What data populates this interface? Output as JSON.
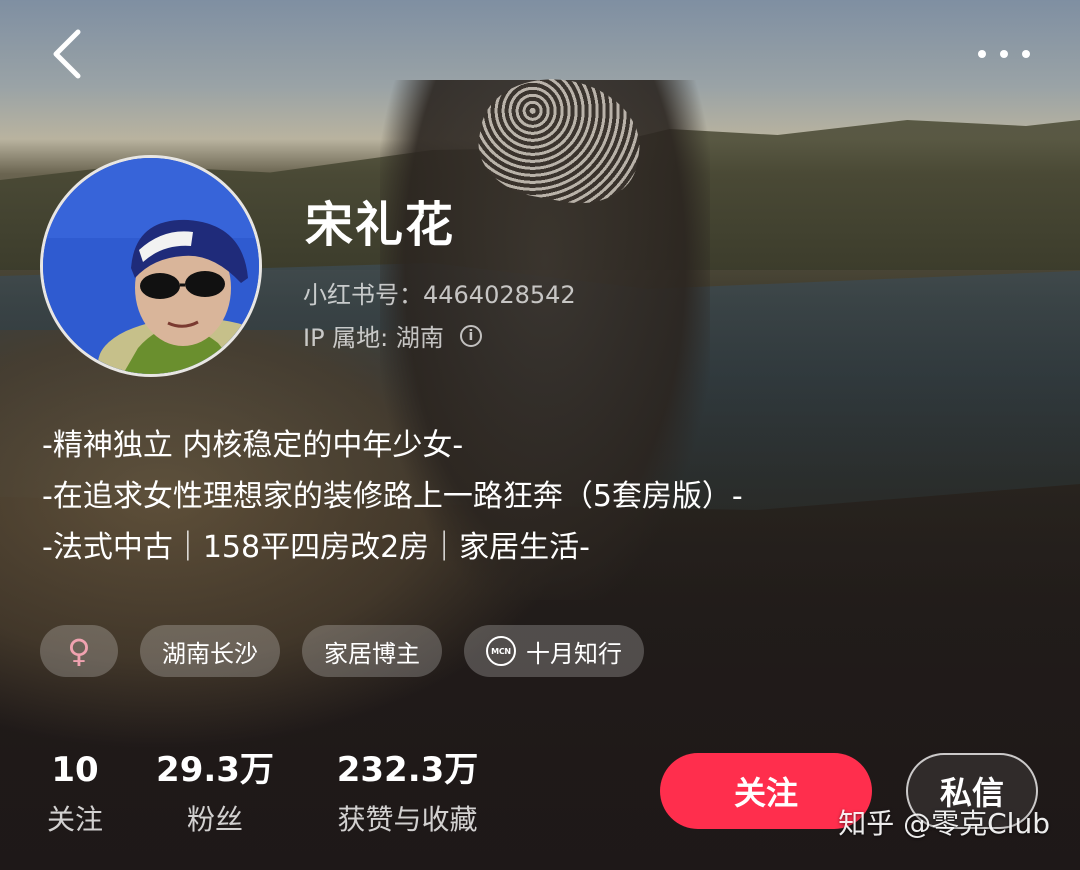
{
  "header": {
    "back_icon": "chevron-left-icon",
    "more_icon": "more-dots-icon"
  },
  "profile": {
    "name": "宋礼花",
    "id_line": "小红书号：4464028542",
    "ip_line": "IP 属地: 湖南",
    "info_icon": "info-icon"
  },
  "bio": [
    "-精神独立 内核稳定的中年少女-",
    "-在追求女性理想家的装修路上一路狂奔（5套房版）-",
    "-法式中古｜158平四房改2房｜家居生活-"
  ],
  "tags": {
    "gender_symbol": "♀",
    "gender_color": "#f0a2b0",
    "location": "湖南长沙",
    "role": "家居博主",
    "mcn_badge": "MCN",
    "mcn_name": "十月知行"
  },
  "stats": {
    "following": {
      "value": "10",
      "label": "关注"
    },
    "fans": {
      "value": "29.3万",
      "label": "粉丝"
    },
    "likes": {
      "value": "232.3万",
      "label": "获赞与收藏"
    }
  },
  "actions": {
    "follow_label": "关注",
    "follow_color": "#ff2e4d",
    "message_label": "私信"
  },
  "watermark": "知乎 @零克Club"
}
